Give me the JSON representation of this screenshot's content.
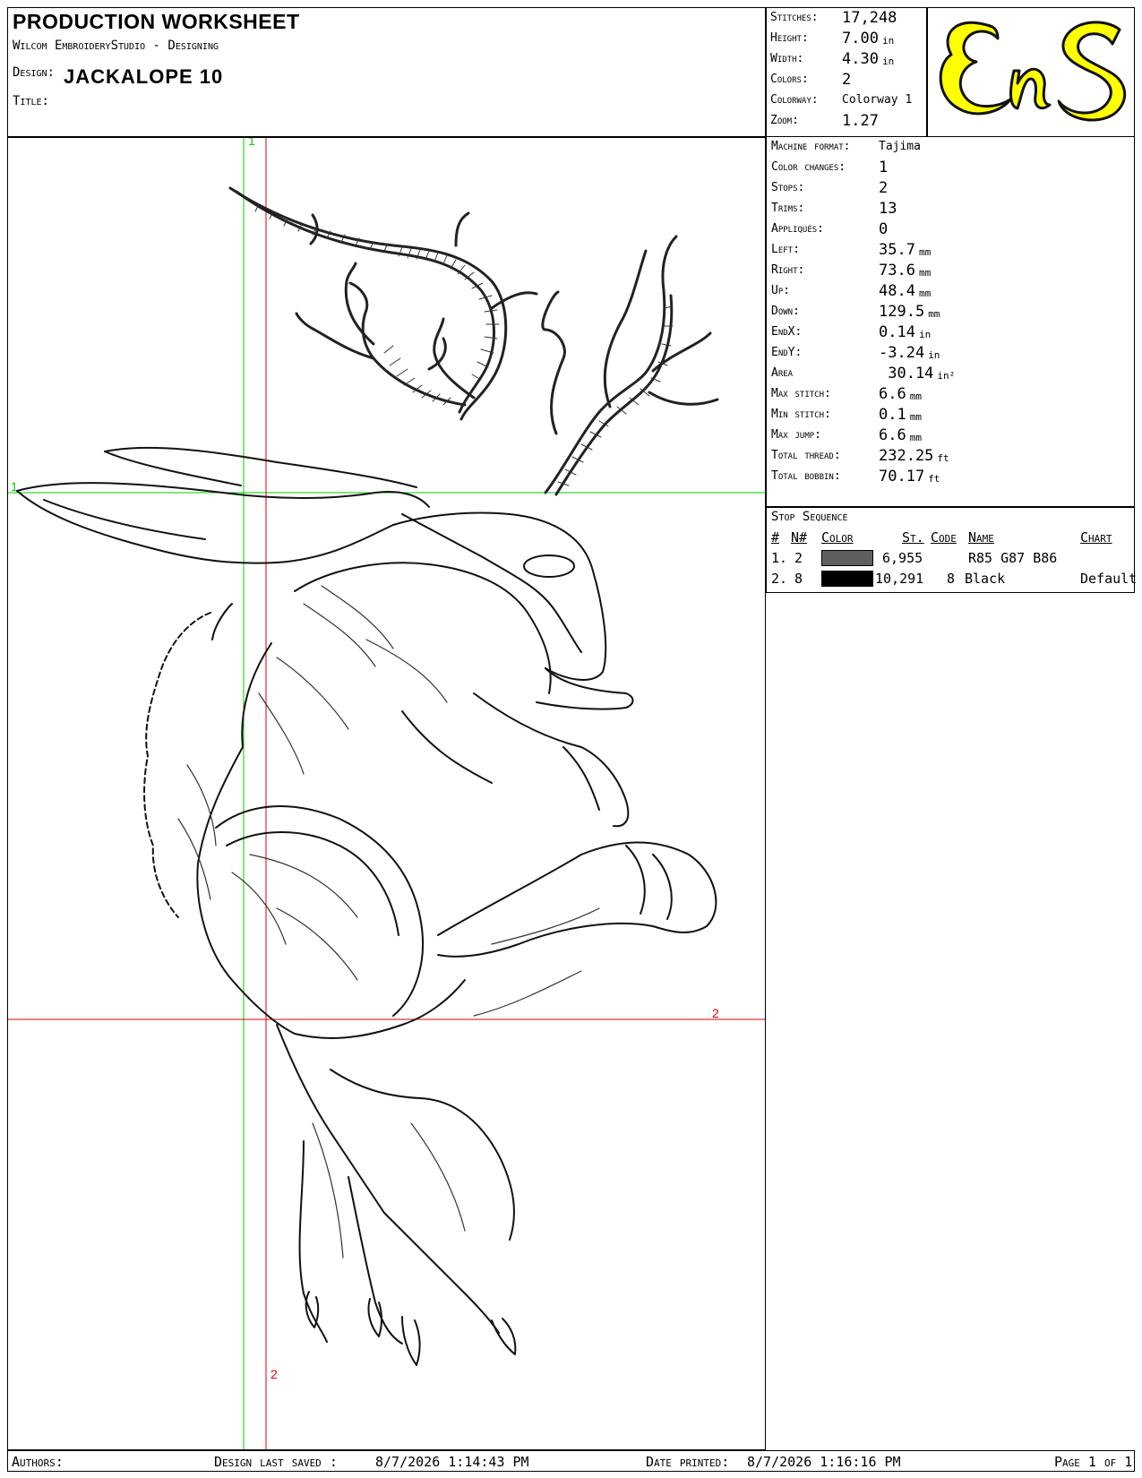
{
  "header": {
    "title": "PRODUCTION WORKSHEET",
    "software": "Wilcom EmbroideryStudio - Designing",
    "design_label": "Design:",
    "design_name": "JACKALOPE  10",
    "title_label": "Title:"
  },
  "stats": [
    {
      "label": "Stitches:",
      "value": "17,248",
      "unit": ""
    },
    {
      "label": "Height:",
      "value": "7.00",
      "unit": "in"
    },
    {
      "label": "Width:",
      "value": "4.30",
      "unit": "in"
    },
    {
      "label": "Colors:",
      "value": "2",
      "unit": ""
    },
    {
      "label": "Colorway:",
      "value": "Colorway 1",
      "unit": ""
    },
    {
      "label": "Zoom:",
      "value": "1.27",
      "unit": ""
    }
  ],
  "logo": {
    "text": "EnS",
    "bg_color": "#ffffff",
    "fill_color": "#ffff00",
    "stroke_color": "#111111"
  },
  "machine": [
    {
      "label": "Machine format:",
      "value": "Tajima",
      "unit": ""
    },
    {
      "label": "Color changes:",
      "value": "1",
      "unit": ""
    },
    {
      "label": "Stops:",
      "value": "2",
      "unit": ""
    },
    {
      "label": "Trims:",
      "value": "13",
      "unit": ""
    },
    {
      "label": "Appliqués:",
      "value": "0",
      "unit": ""
    },
    {
      "label": "Left:",
      "value": "35.7",
      "unit": "mm"
    },
    {
      "label": "Right:",
      "value": "73.6",
      "unit": "mm"
    },
    {
      "label": "Up:",
      "value": "48.4",
      "unit": "mm"
    },
    {
      "label": "Down:",
      "value": "129.5",
      "unit": "mm"
    },
    {
      "label": "EndX:",
      "value": "0.14",
      "unit": "in"
    },
    {
      "label": "EndY:",
      "value": "-3.24",
      "unit": "in"
    },
    {
      "label": "Area",
      "value": " 30.14",
      "unit": "in²"
    },
    {
      "label": "Max stitch:",
      "value": "6.6",
      "unit": "mm"
    },
    {
      "label": "Min stitch:",
      "value": "0.1",
      "unit": "mm"
    },
    {
      "label": "Max jump:",
      "value": "6.6",
      "unit": "mm"
    },
    {
      "label": "Total thread:",
      "value": "232.25",
      "unit": "ft"
    },
    {
      "label": "Total bobbin:",
      "value": "70.17",
      "unit": "ft"
    }
  ],
  "stop_sequence": {
    "title": "Stop Sequence",
    "headers": {
      "num": "#",
      "n": "N#",
      "color": "Color",
      "stitches": "St.",
      "code": "Code",
      "name": "Name",
      "chart": "Chart"
    },
    "rows": [
      {
        "num": "1.",
        "n": "2",
        "swatch": "#5f5f5f",
        "stitches": "6,955",
        "code": "",
        "name": "R85 G87 B86",
        "chart": ""
      },
      {
        "num": "2.",
        "n": "8",
        "swatch": "#000000",
        "stitches": "10,291",
        "code": "8",
        "name": "Black",
        "chart": "Default"
      }
    ]
  },
  "design_area": {
    "guide_labels": {
      "green_v": "1",
      "green_h": "1",
      "red_v": "2",
      "red_h": "2"
    },
    "guide_colors": {
      "green": "#00cc00",
      "red": "#e00000"
    }
  },
  "footer": {
    "authors_label": "Authors:",
    "saved_label": "Design last saved :",
    "saved_value": "8/7/2026 1:14:43 PM",
    "printed_label": "Date printed:",
    "printed_value": "8/7/2026 1:16:16 PM",
    "page": "Page 1 of 1"
  }
}
